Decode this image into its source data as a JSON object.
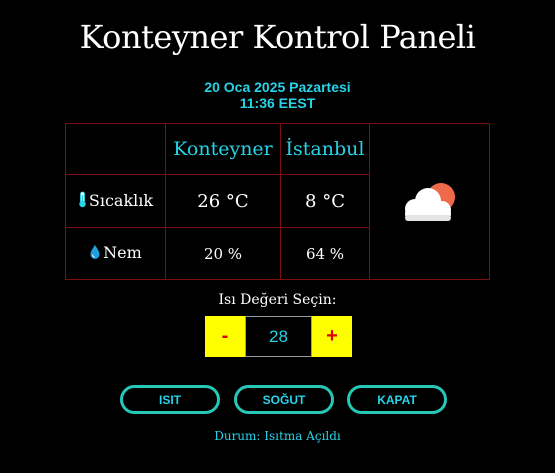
{
  "header": {
    "title": "Konteyner Kontrol Paneli",
    "date": "20 Oca 2025 Pazartesi",
    "time": "11:36 EEST"
  },
  "table": {
    "columns": [
      "Konteyner",
      "İstanbul"
    ],
    "rows": [
      {
        "icon": "thermometer-icon",
        "label": "Sıcaklık",
        "container": "26 °C",
        "istanbul": "8 °C"
      },
      {
        "icon": "water-drop-icon",
        "label": "Nem",
        "container": "20 %",
        "istanbul": "64 %"
      }
    ],
    "weather_icon": "partly-cloudy-icon"
  },
  "heat": {
    "label": "Isı Değeri Seçin:",
    "minus_label": "-",
    "value": "28",
    "plus_label": "+"
  },
  "actions": {
    "heat_label": "ISIT",
    "cool_label": "SOĞUT",
    "off_label": "KAPAT"
  },
  "status": {
    "text": "Durum: Isıtma Açıldı"
  },
  "colors": {
    "accent": "#27d3e8",
    "button_border": "#27c7b8",
    "table_border": "#7a0f0f",
    "stepper_bg": "#ffff00",
    "stepper_text": "#e00000"
  }
}
